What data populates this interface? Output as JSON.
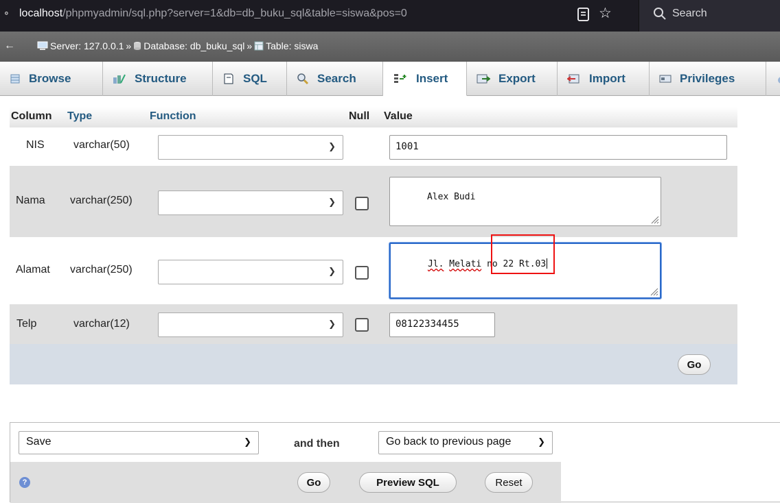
{
  "browser": {
    "url_host": "localhost",
    "url_path": "/phpmyadmin/sql.php?server=1&db=db_buku_sql&table=siswa&pos=0",
    "search_placeholder": "Search"
  },
  "breadcrumb": {
    "server": "Server: 127.0.0.1",
    "separator": "»",
    "database": "Database: db_buku_sql",
    "table": "Table: siswa"
  },
  "tabs": [
    {
      "label": "Browse",
      "icon": "browse-icon"
    },
    {
      "label": "Structure",
      "icon": "structure-icon"
    },
    {
      "label": "SQL",
      "icon": "sql-icon"
    },
    {
      "label": "Search",
      "icon": "search-icon"
    },
    {
      "label": "Insert",
      "icon": "insert-icon",
      "active": true
    },
    {
      "label": "Export",
      "icon": "export-icon"
    },
    {
      "label": "Import",
      "icon": "import-icon"
    },
    {
      "label": "Privileges",
      "icon": "privileges-icon"
    }
  ],
  "insert_form": {
    "headers": {
      "column": "Column",
      "type": "Type",
      "function": "Function",
      "null": "Null",
      "value": "Value"
    },
    "rows": [
      {
        "column": "NIS",
        "type": "varchar(50)",
        "function": "",
        "value": "1001"
      },
      {
        "column": "Nama",
        "type": "varchar(250)",
        "function": "",
        "value": "Alex Budi"
      },
      {
        "column": "Alamat",
        "type": "varchar(250)",
        "function": "",
        "value_part1": "Jl.",
        "value_part2": "Melati",
        "value_part3": " no 22 Rt.03"
      },
      {
        "column": "Telp",
        "type": "varchar(12)",
        "function": "",
        "value": "08122334455"
      }
    ],
    "go_label": "Go"
  },
  "after_insert": {
    "action": "Save",
    "and_then": "and then",
    "next": "Go back to previous page",
    "go_label": "Go",
    "preview_label": "Preview SQL",
    "reset_label": "Reset"
  },
  "colors": {
    "accent_link": "#235a81",
    "focus_border": "#2b69c9",
    "highlight": "#e11111"
  }
}
